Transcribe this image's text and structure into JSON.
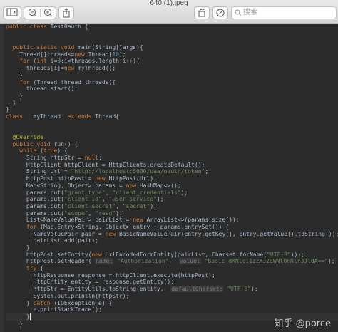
{
  "window": {
    "title": "640 (1).jpeg"
  },
  "toolbar": {
    "search_placeholder": "搜索",
    "buttons": [
      {
        "name": "sidebar-toggle-icon"
      },
      {
        "name": "zoom-out-icon"
      },
      {
        "name": "zoom-in-icon"
      },
      {
        "name": "share-icon"
      },
      {
        "name": "rotate-icon"
      },
      {
        "name": "markup-pen-icon"
      }
    ]
  },
  "code_lines": [
    "public class TestOauth {",
    "",
    "",
    "  public static void main(String[]args){",
    "    Thread[]threads=new Thread[10];",
    "    for (int i=0;i<threads.length;i++){",
    "      threads[i]=new myThread();",
    "    }",
    "    for (Thread thread:threads){",
    "      thread.start();",
    "    }",
    "  }",
    "}",
    "class   myThread  extends Thread{",
    "",
    "",
    "  @Override",
    "  public void run() {",
    "    while (true) {",
    "      String httpStr = null;",
    "      HttpClient httpClient = HttpClients.createDefault();",
    "      String Url = \"http://localhost:5000/uaa/oauth/token\";",
    "      HttpPost httpPost = new HttpPost(Url);",
    "      Map<String, Object> params = new HashMap<>();",
    "      params.put(\"grant_type\", \"client_credentials\");",
    "      params.put(\"client_id\", \"user-service\");",
    "      params.put(\"client_secret\", \"secret\");",
    "      params.put(\"scope\", \"read\");",
    "      List<NameValuePair> pairList = new ArrayList<>(params.size());",
    "      for (Map.Entry<String, Object> entry : params.entrySet()) {",
    "        NameValuePair pair = new BasicNameValuePair(entry.getKey(), entry.getValue().toString());",
    "        pairList.add(pair);",
    "      }",
    "      httpPost.setEntity(new UrlEncodedFormEntity(pairList, Charset.forName(\"UTF-8\")));",
    "      httpPost.setHeader( name: \"Authorization\",  value: \"Basic dXNlci1zZXJ2aWNlOnNlY3JldA==\");",
    "      try {",
    "        HttpResponse response = httpClient.execute(httpPost);",
    "        HttpEntity entity = response.getEntity();",
    "        httpStr = EntityUtils.toString(entity,  defaultCharset: \"UTF-8\");",
    "        System.out.println(httpStr);",
    "      } catch (IOException e) {",
    "        e.printStackTrace();",
    "      }",
    "    }",
    "",
    "  }"
  ],
  "watermark": "知乎 @porce"
}
